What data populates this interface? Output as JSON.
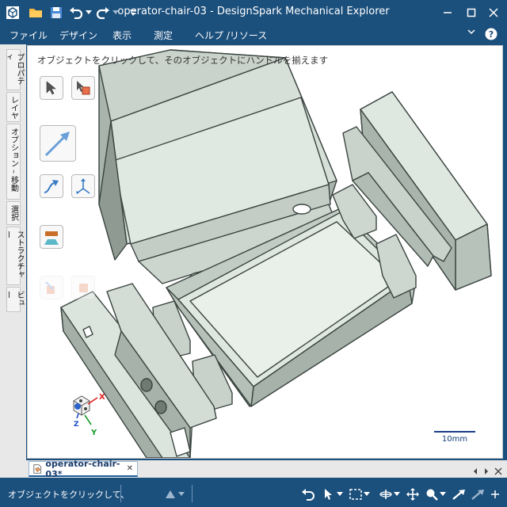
{
  "window": {
    "title": "operator-chair-03 - DesignSpark Mechanical Explorer"
  },
  "menu": {
    "items": [
      "ファイル",
      "デザイン",
      "表示",
      "測定",
      "ヘルプ /リソース"
    ]
  },
  "side_tabs": [
    "プロパティ",
    "レイヤ",
    "オプション – 移動",
    "選択",
    "ストラクチャー",
    "ビュー"
  ],
  "viewport": {
    "hint": "オブジェクトをクリックして、そのオブジェクトにハンドルを揃えます",
    "scale_label": "10mm",
    "axis_x": "X",
    "axis_y": "Y",
    "axis_z": "Z"
  },
  "document_tab": {
    "label": "operator-chair-03*",
    "close": "✕"
  },
  "status": {
    "text": "オブジェクトをクリックして、"
  },
  "colors": {
    "chrome": "#1b4f7c",
    "model_face": "#dfe8e0",
    "model_side": "#9aa69e",
    "edge": "#3a4440"
  }
}
